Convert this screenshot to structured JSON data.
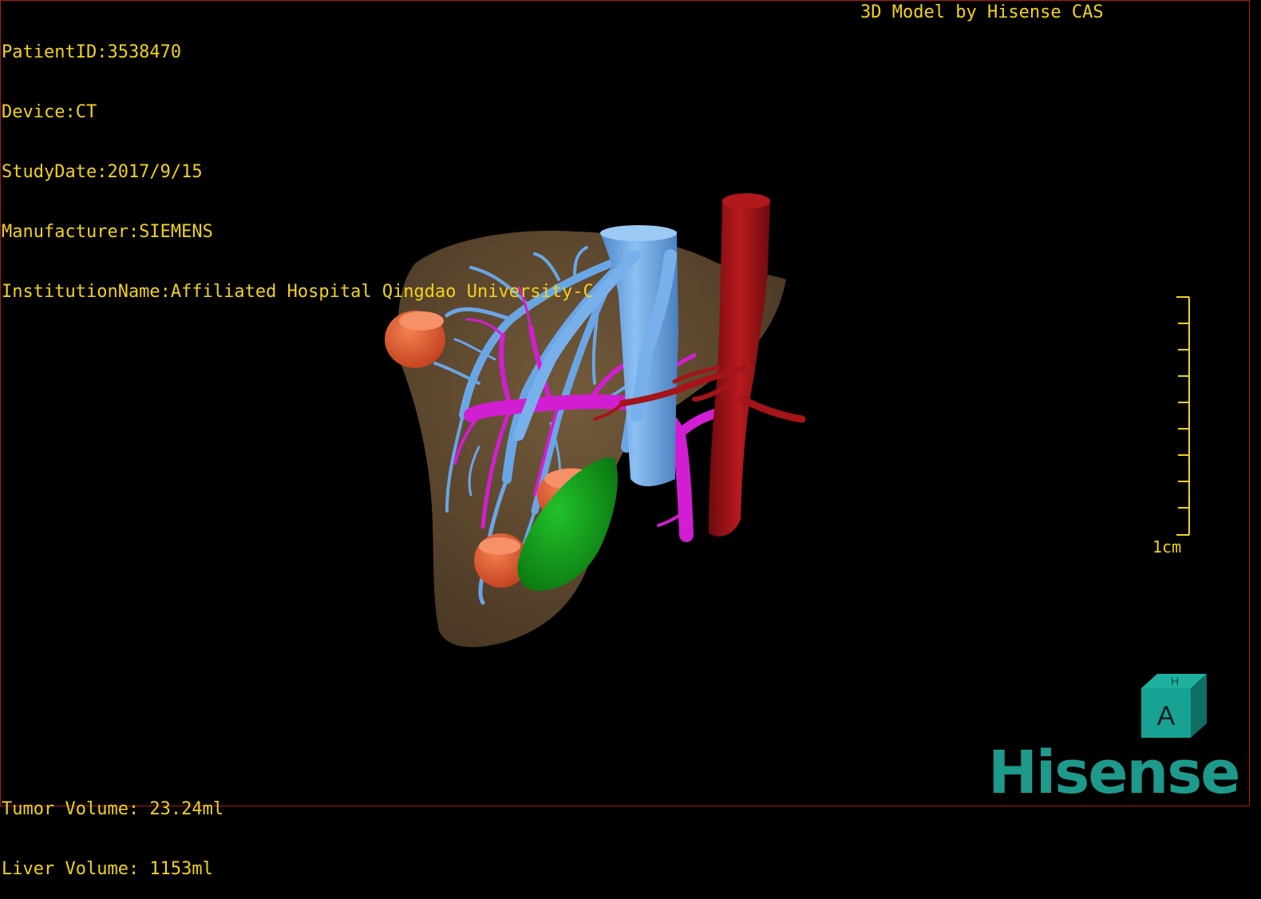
{
  "window": {
    "meta": [
      "PatientID:3538470",
      "Device:CT",
      "StudyDate:2017/9/15",
      "Manufacturer:SIEMENS",
      "InstitutionName:Affiliated Hospital Qingdao University-C"
    ],
    "credit": "3D Model by Hisense CAS"
  },
  "volumes": {
    "tumor": "Tumor Volume: 23.24ml",
    "liver": "Liver Volume: 1153ml"
  },
  "scale": {
    "label": "1cm"
  },
  "orientation": {
    "face_label": "A",
    "top_label": "H"
  },
  "brand": "Hisense",
  "colors": {
    "overlay_text": "#f2d21a",
    "liver": "#6b5236",
    "portal_vein": "#d21ed2",
    "hepatic_vein": "#6aa6e6",
    "artery": "#9e1216",
    "tumor": "#e8582e",
    "gallbladder": "#129a1a",
    "brand": "#1e9a8c"
  }
}
